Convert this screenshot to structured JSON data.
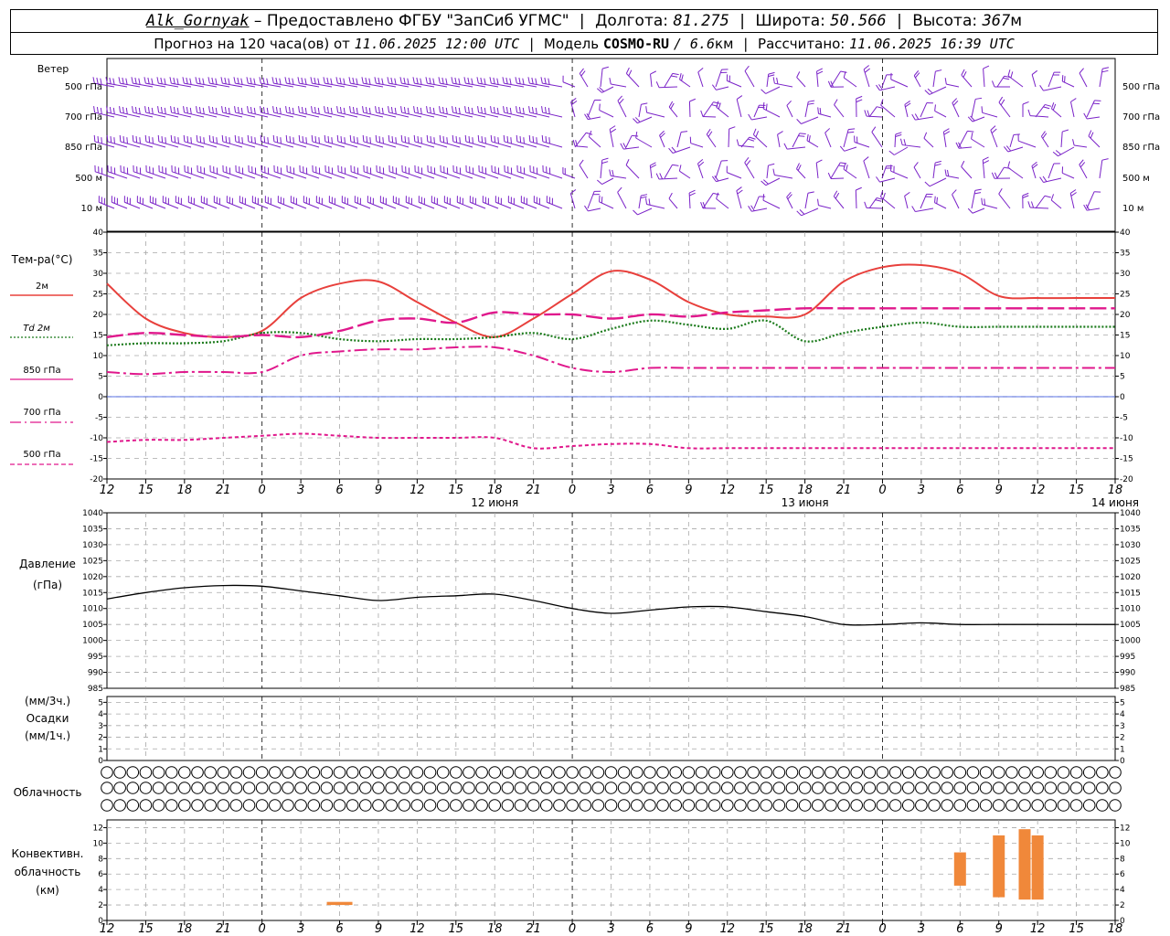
{
  "header": {
    "station": "Alk_Gornyak",
    "provider": "– Предоставлено ФГБУ \"ЗапСиб УГМС\"",
    "lon_label": "Долгота:",
    "lon_value": "81.275",
    "lat_label": "Широта:",
    "lat_value": "50.566",
    "alt_label": "Высота:",
    "alt_value": "367",
    "alt_unit": "м",
    "forecast_label": "Прогноз на 120 часа(ов) от",
    "forecast_start": "11.06.2025 12:00 UTC",
    "model_label": "Модель",
    "model_name": "COSMO-RU",
    "model_res": "/ 6.6",
    "model_unit": "км",
    "calc_label": "Рассчитано:",
    "calc_time": "11.06.2025 16:39 UTC"
  },
  "panels": {
    "wind": {
      "title": "Ветер",
      "levels": [
        "500 гПа",
        "700 гПа",
        "850 гПа",
        "500 м",
        "10   м"
      ]
    },
    "temp": {
      "title": "Тем-ра(°C)",
      "legend": [
        {
          "label": "2м",
          "color": "#e8403c",
          "dash": "solid"
        },
        {
          "label": "Td  2м",
          "color": "#1a7a1a",
          "dash": "dotted"
        },
        {
          "label": "850 гПа",
          "color": "#e0188c",
          "dash": "long"
        },
        {
          "label": "700 гПа",
          "color": "#e0188c",
          "dash": "dashdot"
        },
        {
          "label": "500 гПа",
          "color": "#e0188c",
          "dash": "short"
        }
      ],
      "y_ticks": [
        40,
        35,
        30,
        25,
        20,
        15,
        10,
        5,
        0,
        -5,
        -10,
        -15,
        -20
      ]
    },
    "pressure": {
      "title_1": "Давление",
      "title_2": "(гПа)",
      "y_ticks": [
        1040,
        1035,
        1030,
        1025,
        1020,
        1015,
        1010,
        1005,
        1000,
        995,
        990,
        985
      ]
    },
    "precip": {
      "title_1": "(мм/3ч.)",
      "title_2": "Осадки",
      "title_3": "(мм/1ч.)",
      "y_ticks": [
        5,
        4,
        3,
        2,
        1,
        0
      ]
    },
    "cloud": {
      "title": "Облачность"
    },
    "conv": {
      "title_1": "Конвективн.",
      "title_2": "облачность",
      "title_3": "(км)",
      "y_ticks": [
        12,
        10,
        8,
        6,
        4,
        2,
        0
      ]
    }
  },
  "time_axis": {
    "tick_labels": [
      "12",
      "15",
      "18",
      "21",
      "0",
      "3",
      "6",
      "9",
      "12",
      "15",
      "18",
      "21",
      "0",
      "3",
      "6",
      "9",
      "12",
      "15",
      "18",
      "21",
      "0",
      "3",
      "6",
      "9",
      "12",
      "15",
      "18"
    ],
    "day_labels": [
      {
        "text": "12 июня",
        "hour": 24
      },
      {
        "text": "13 июня",
        "hour": 48
      },
      {
        "text": "14 июня",
        "hour": 72
      }
    ]
  },
  "chart_data": [
    {
      "type": "line",
      "title": "",
      "ylabel": "Тем-ра(°C)",
      "ylim": [
        -20,
        40
      ],
      "x_hours_since": "11.06.2025 12:00 UTC",
      "x": [
        0,
        3,
        6,
        9,
        12,
        15,
        18,
        21,
        24,
        27,
        30,
        33,
        36,
        39,
        42,
        45,
        48,
        51,
        54,
        57,
        60,
        63,
        66,
        69,
        72,
        75,
        78
      ],
      "series": [
        {
          "name": "2м",
          "color": "#e8403c",
          "values": [
            27.5,
            19,
            15.5,
            14.5,
            16,
            24,
            27.5,
            28,
            23,
            18,
            14.5,
            19,
            25,
            30.5,
            28.5,
            23,
            20,
            19.5,
            20,
            28,
            31.5,
            32,
            30,
            24.5,
            24,
            24,
            24
          ]
        },
        {
          "name": "Td  2м",
          "color": "#1a7a1a",
          "values": [
            12.5,
            13,
            13,
            13.5,
            15.5,
            15.5,
            14,
            13.5,
            14,
            14,
            14.5,
            15.5,
            14,
            16.5,
            18.5,
            17.5,
            16.5,
            18.5,
            13.5,
            15.5,
            17,
            18,
            17,
            17,
            17,
            17,
            17
          ]
        },
        {
          "name": "850 гПа",
          "color": "#e0188c",
          "values": [
            14.5,
            15.5,
            15,
            14.5,
            15,
            14.5,
            16,
            18.5,
            19,
            18,
            20.5,
            20,
            20,
            19,
            20,
            19.5,
            20.5,
            21,
            21.5,
            21.5,
            21.5,
            21.5,
            21.5,
            21.5,
            21.5,
            21.5,
            21.5
          ]
        },
        {
          "name": "700 гПа",
          "color": "#e0188c",
          "values": [
            6,
            5.5,
            6,
            6,
            6,
            10,
            11,
            11.5,
            11.5,
            12,
            12,
            10,
            7,
            6,
            7,
            7,
            7,
            7,
            7,
            7,
            7,
            7,
            7,
            7,
            7,
            7,
            7
          ]
        },
        {
          "name": "500 гПа",
          "color": "#e0188c",
          "values": [
            -11,
            -10.5,
            -10.5,
            -10,
            -9.5,
            -9,
            -9.5,
            -10,
            -10,
            -10,
            -10,
            -12.5,
            -12,
            -11.5,
            -11.5,
            -12.5,
            -12.5,
            -12.5,
            -12.5,
            -12.5,
            -12.5,
            -12.5,
            -12.5,
            -12.5,
            -12.5,
            -12.5,
            -12.5
          ]
        }
      ]
    },
    {
      "type": "line",
      "title": "",
      "ylabel": "Давление (гПа)",
      "ylim": [
        985,
        1040
      ],
      "x_hours_since": "11.06.2025 12:00 UTC",
      "x": [
        0,
        3,
        6,
        9,
        12,
        15,
        18,
        21,
        24,
        27,
        30,
        33,
        36,
        39,
        42,
        45,
        48,
        51,
        54,
        57,
        60,
        63,
        66,
        69,
        72,
        75,
        78
      ],
      "series": [
        {
          "name": "",
          "color": "#000000",
          "values": [
            1013,
            1015,
            1016.5,
            1017.2,
            1017,
            1015.5,
            1014,
            1012.5,
            1013.5,
            1014,
            1014.5,
            1012.5,
            1010,
            1008.5,
            1009.5,
            1010.5,
            1010.5,
            1009,
            1007.5,
            1005,
            1005,
            1005.5,
            1005,
            1005,
            1005,
            1005,
            1005
          ]
        }
      ]
    },
    {
      "type": "bar",
      "title": "",
      "ylabel": "Конвективн. облачность (км)",
      "ylim": [
        0,
        13
      ],
      "x_hours_since": "11.06.2025 12:00 UTC",
      "bars": [
        {
          "hour": 18,
          "base": 2,
          "top": 2.4
        },
        {
          "hour": 66,
          "base": 4.5,
          "top": 8.8
        },
        {
          "hour": 69,
          "base": 3,
          "top": 11
        },
        {
          "hour": 71,
          "base": 2.7,
          "top": 11.8
        },
        {
          "hour": 72,
          "base": 2.7,
          "top": 11
        }
      ],
      "color": "#f0883a"
    },
    {
      "type": "table",
      "title": "",
      "row_label": "Облачность",
      "rows": [
        {
          "name": "upper",
          "values": [
            0,
            0,
            0,
            0,
            0,
            0,
            0,
            0,
            0,
            0,
            0,
            0,
            0,
            0,
            0,
            0,
            0,
            0,
            0,
            0,
            0,
            0,
            0,
            0,
            0,
            0,
            0,
            0,
            0,
            0,
            0,
            0,
            0,
            0,
            0,
            0,
            0,
            0,
            0,
            0,
            0,
            0,
            0,
            0,
            0,
            0,
            0,
            0,
            0,
            0,
            0,
            0,
            0,
            0,
            0,
            0,
            0,
            0,
            0,
            0,
            0,
            0,
            0,
            0,
            0,
            0,
            0,
            0,
            0,
            0,
            0,
            0,
            0,
            0,
            0,
            0,
            0,
            0,
            0,
            0
          ]
        },
        {
          "name": "middle",
          "values": [
            0,
            0,
            0,
            0,
            0,
            0,
            0,
            0,
            0,
            0,
            0,
            0,
            0,
            0,
            0,
            0,
            0,
            0,
            0,
            0,
            0,
            0,
            0,
            0,
            0,
            0,
            0,
            0,
            0,
            0,
            0,
            0,
            0,
            0,
            0,
            0,
            0,
            0,
            0,
            0,
            0,
            0,
            0,
            0,
            0,
            0,
            0,
            0,
            0,
            0,
            0,
            0,
            0,
            0,
            0,
            0,
            0,
            0,
            0,
            0,
            0,
            0,
            0,
            0,
            0,
            0,
            0,
            0,
            0,
            0,
            0,
            0,
            0,
            0,
            0,
            0,
            0,
            0,
            0,
            0
          ]
        },
        {
          "name": "lower",
          "values": [
            0,
            0,
            0,
            0,
            0,
            0,
            0,
            0,
            0,
            0,
            0,
            0,
            0,
            0,
            0,
            0,
            0,
            0,
            0,
            0,
            0,
            0,
            0,
            0,
            0,
            0,
            0,
            0,
            0,
            0,
            0,
            0,
            0,
            0,
            0,
            0,
            0,
            0,
            0,
            0,
            0,
            0,
            0,
            0,
            0,
            0,
            0,
            0,
            0,
            0,
            0,
            0,
            0,
            0,
            0,
            0,
            0,
            0,
            0,
            0,
            0,
            0,
            0,
            0,
            0,
            0,
            0,
            0,
            0,
            0,
            0,
            0,
            0,
            0,
            0,
            0,
            0,
            0,
            0,
            0
          ]
        }
      ]
    }
  ]
}
